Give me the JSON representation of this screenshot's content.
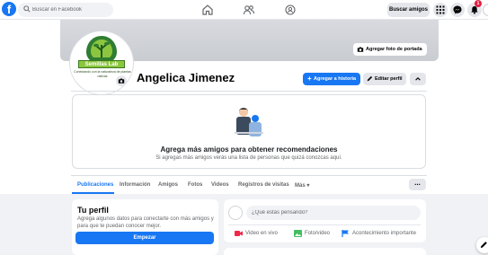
{
  "topbar": {
    "logo_letter": "f",
    "search_placeholder": "Buscar en Facebook",
    "find_friends_label": "Buscar amigos",
    "notifications_count": "1"
  },
  "cover": {
    "add_cover_label": "Agregar foto de portada"
  },
  "avatar": {
    "logo_text": "Semillas Lab",
    "caption": "Conectando con la naturaleza de plantas nativas"
  },
  "profile": {
    "name": "Angelica Jimenez",
    "add_story_label": "Agregar a historia",
    "edit_profile_label": "Editar perfil"
  },
  "suggestions": {
    "title": "Agrega más amigos para obtener recomendaciones",
    "subtitle": "Si agregas más amigos verás una lista de personas que quizá conozcas aquí."
  },
  "tabs": [
    {
      "label": "Publicaciones"
    },
    {
      "label": "Información"
    },
    {
      "label": "Amigos"
    },
    {
      "label": "Fotos"
    },
    {
      "label": "Videos"
    },
    {
      "label": "Registros de visitas"
    },
    {
      "label": "Más"
    }
  ],
  "tabs_more_button": "...",
  "profile_card": {
    "title": "Tu perfil",
    "text": "Agrega algunos datos para conectarte con más amigos y para que te puedan conocer mejor.",
    "button_label": "Empezar"
  },
  "composer": {
    "placeholder": "¿Qué estás pensando?",
    "actions": [
      {
        "label": "Video en vivo",
        "color": "#f02849"
      },
      {
        "label": "Foto/video",
        "color": "#45bd62"
      },
      {
        "label": "Acontecimiento importante",
        "color": "#1877f2"
      }
    ]
  },
  "colors": {
    "brand": "#1877f2",
    "badge": "#e41e3f",
    "logo_green": "#8cc63f"
  }
}
